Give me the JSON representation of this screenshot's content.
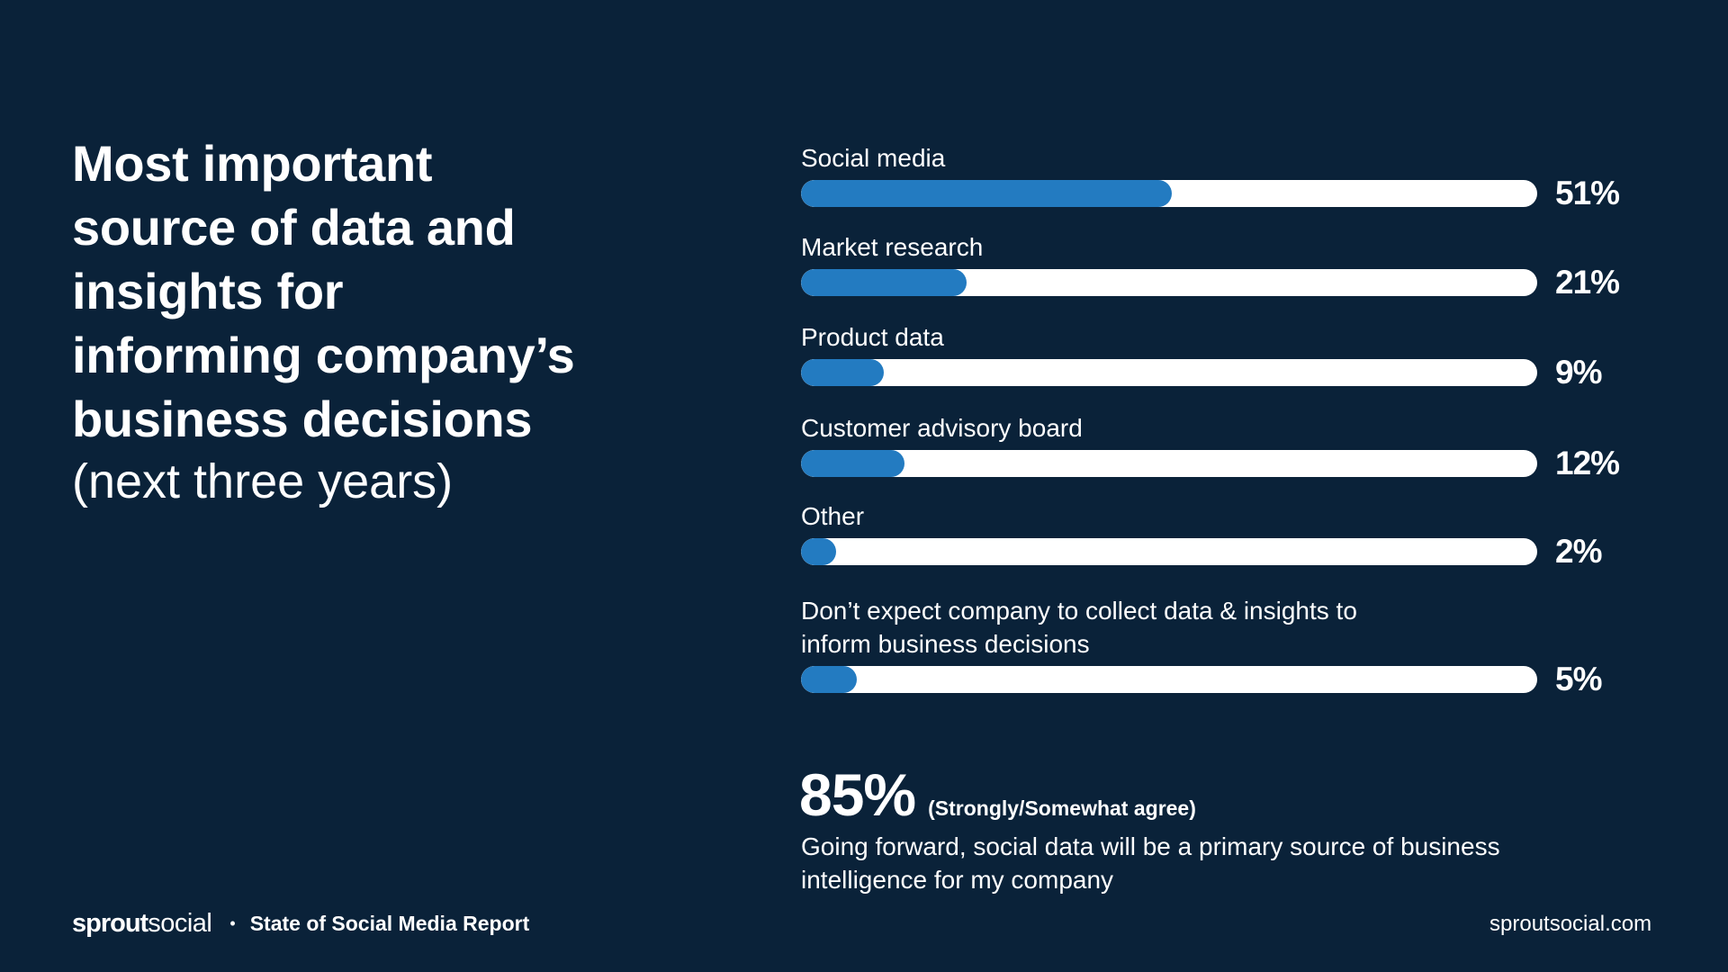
{
  "colors": {
    "background": "#0a2239",
    "bar_fill": "#237bc1",
    "bar_track": "#ffffff",
    "text": "#ffffff"
  },
  "title": {
    "lines": [
      "Most important",
      "source of data and",
      "insights for",
      "informing company’s",
      "business decisions"
    ],
    "subtitle": "(next three years)"
  },
  "chart_data": {
    "type": "bar",
    "orientation": "horizontal",
    "title": "Most important source of data and insights for informing company’s business decisions (next three years)",
    "categories": [
      "Social media",
      "Market research",
      "Product data",
      "Customer advisory board",
      "Other",
      "Don’t expect company to collect data & insights to inform business decisions"
    ],
    "category_label_lines": [
      [
        "Social media"
      ],
      [
        "Market research"
      ],
      [
        "Product data"
      ],
      [
        "Customer advisory board"
      ],
      [
        "Other"
      ],
      [
        "Don’t expect company to collect data & insights to",
        "inform business decisions"
      ]
    ],
    "values": [
      51,
      21,
      9,
      12,
      2,
      5
    ],
    "value_labels": [
      "51%",
      "21%",
      "9%",
      "12%",
      "2%",
      "5%"
    ],
    "unit": "%",
    "xlim": [
      0,
      100
    ],
    "grid": false,
    "legend": "none"
  },
  "stat": {
    "value": "85%",
    "note": "(Strongly/Somewhat agree)",
    "description": "Going forward, social data will be a primary source of business intelligence for my company"
  },
  "footer": {
    "logo_bold": "sprout",
    "logo_light": "social",
    "separator": "•",
    "report_name": "State of Social Media Report",
    "website": "sproutsocial.com"
  }
}
